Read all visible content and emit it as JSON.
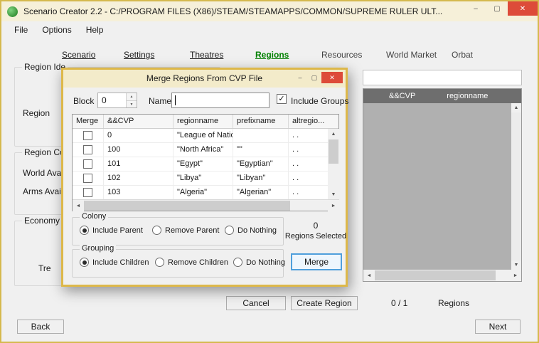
{
  "icons": {
    "minimize": "–",
    "maximize": "▢",
    "close": "✕",
    "up": "▲",
    "down": "▼",
    "left": "◄",
    "right": "►",
    "check": "✓"
  },
  "window": {
    "title": "Scenario Creator 2.2 - C:/PROGRAM FILES (X86)/STEAM/STEAMAPPS/COMMON/SUPREME RULER ULT..."
  },
  "menu": [
    "File",
    "Options",
    "Help"
  ],
  "tabs": [
    "Scenario",
    "Settings",
    "Theatres",
    "Regions",
    "Resources",
    "World Market",
    "Orbat"
  ],
  "left_panel": {
    "group1_title": "Region Ide",
    "region_label": "Region",
    "group2_title": "Region Co",
    "world_avail_label": "World Avail",
    "arms_avail_label": "Arms Avail",
    "group3_title": "Economy",
    "tre_label": "Tre"
  },
  "right_panel": {
    "filter_value": "",
    "columns": [
      "&&CVP",
      "regionname"
    ]
  },
  "footer": {
    "cancel": "Cancel",
    "create_region": "Create Region",
    "count": "0 / 1",
    "regions": "Regions",
    "back": "Back",
    "next": "Next"
  },
  "dialog": {
    "title": "Merge Regions From CVP File",
    "block_label": "Block",
    "block_value": "0",
    "name_label": "Name",
    "name_value": "",
    "include_groups_label": "Include Groups",
    "include_groups_checked": true,
    "table": {
      "columns": [
        "Merge",
        "&&CVP",
        "regionname",
        "prefixname",
        "altregio..."
      ],
      "rows": [
        {
          "checked": false,
          "cvp": "0",
          "regionname": "\"League of Natio...",
          "prefixname": "",
          "altregionname": ". ."
        },
        {
          "checked": false,
          "cvp": "100",
          "regionname": "\"North Africa\"",
          "prefixname": "\"\"",
          "altregionname": ". ."
        },
        {
          "checked": false,
          "cvp": "101",
          "regionname": "\"Egypt\"",
          "prefixname": "\"Egyptian\"",
          "altregionname": ". ."
        },
        {
          "checked": false,
          "cvp": "102",
          "regionname": "\"Libya\"",
          "prefixname": "\"Libyan\"",
          "altregionname": ". ."
        },
        {
          "checked": false,
          "cvp": "103",
          "regionname": "\"Algeria\"",
          "prefixname": "\"Algerian\"",
          "altregionname": ". ."
        }
      ]
    },
    "colony_group": {
      "title": "Colony",
      "options": [
        "Include Parent",
        "Remove Parent",
        "Do Nothing"
      ],
      "selected": "Include Parent"
    },
    "grouping_group": {
      "title": "Grouping",
      "options": [
        "Include Children",
        "Remove Children",
        "Do Nothing"
      ],
      "selected": "Include Children"
    },
    "selected_count": "0",
    "selected_caption": "Regions Selected",
    "merge_button": "Merge"
  },
  "colors": {
    "frame_gold": "#d5b94e",
    "titlebar_bg": "#f6f0d9",
    "close_red": "#dd4b39",
    "active_tab_green": "#008000",
    "list_header_bg": "#6e6e6e",
    "list_body_bg": "#b0b0b0",
    "focus_blue": "#4f9fdc"
  }
}
